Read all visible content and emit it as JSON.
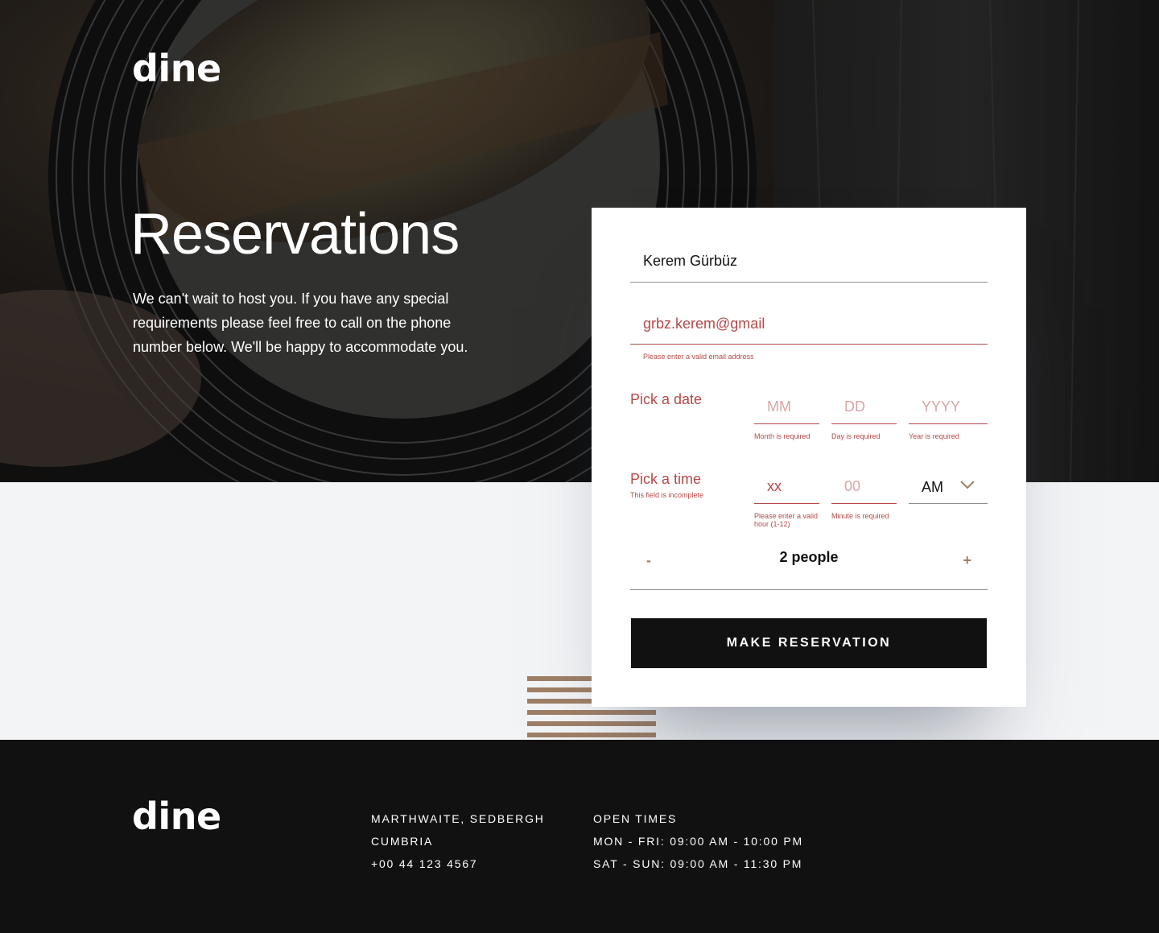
{
  "brand": {
    "logo": "dine"
  },
  "hero": {
    "title": "Reservations",
    "description": "We can't wait to host you. If you have any special requirements please feel free to call on the phone number below. We'll be happy to accommodate you."
  },
  "form": {
    "name_value": "Kerem Gürbüz",
    "email_value": "grbz.kerem@gmail",
    "email_error": "Please enter a valid email address",
    "date": {
      "label": "Pick a date",
      "month_placeholder": "MM",
      "day_placeholder": "DD",
      "year_placeholder": "YYYY",
      "month_error": "Month is required",
      "day_error": "Day is required",
      "year_error": "Year is required"
    },
    "time": {
      "label": "Pick a time",
      "label_error": "This field is incomplete",
      "hour_value": "xx",
      "minute_placeholder": "00",
      "period": "AM",
      "hour_error": "Please enter a valid hour (1-12)",
      "minute_error": "Minute is required"
    },
    "people": {
      "minus": "-",
      "count": "2 people",
      "plus": "+"
    },
    "submit_label": "MAKE RESERVATION"
  },
  "footer": {
    "logo": "dine",
    "address": [
      "MARTHWAITE, SEDBERGH",
      "CUMBRIA",
      "+00 44 123 4567"
    ],
    "hours": [
      "OPEN TIMES",
      "MON - FRI: 09:00 AM - 10:00 PM",
      "SAT - SUN: 09:00 AM - 11:30 PM"
    ]
  },
  "colors": {
    "accent_error": "#b54949",
    "pattern": "#9e7f66",
    "dark": "#111112",
    "light_bg": "#f3f4f6"
  }
}
